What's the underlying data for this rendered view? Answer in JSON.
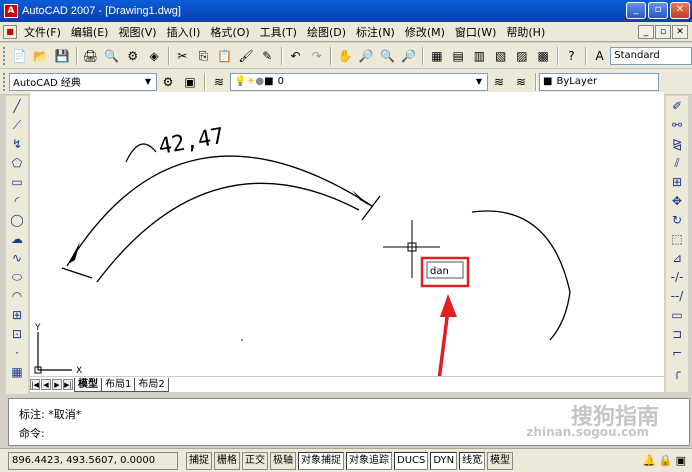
{
  "window": {
    "title": "AutoCAD 2007 - [Drawing1.dwg]",
    "app_badge": "A"
  },
  "menubar": {
    "items": [
      "文件(F)",
      "编辑(E)",
      "视图(V)",
      "插入(I)",
      "格式(O)",
      "工具(T)",
      "绘图(D)",
      "标注(N)",
      "修改(M)",
      "窗口(W)",
      "帮助(H)"
    ]
  },
  "toolbar_std": {
    "text_style": "Standard"
  },
  "toolbar_workspace": {
    "workspace": "AutoCAD 经典",
    "layer": "0",
    "linetype": "ByLayer"
  },
  "drawing": {
    "dimension_text": "42,47",
    "input_text": "dan",
    "ucs_x": "X",
    "ucs_y": "Y"
  },
  "layout_tabs": [
    "模型",
    "布局1",
    "布局2"
  ],
  "command": {
    "history": "标注: *取消*",
    "prompt": "命令:"
  },
  "status": {
    "coords": "896.4423, 493.5607, 0.0000",
    "buttons": [
      "捕捉",
      "栅格",
      "正交",
      "极轴",
      "对象捕捉",
      "对象追踪",
      "DUCS",
      "DYN",
      "线宽",
      "模型"
    ],
    "on_buttons": [
      "对象捕捉",
      "对象追踪",
      "DUCS",
      "DYN",
      "线宽"
    ]
  },
  "watermark": {
    "line1": "搜狗指南",
    "line2": "zhinan.sogou.com"
  },
  "colors": {
    "titlebar": "#0a4fc4",
    "annotation_red": "#e02020",
    "canvas": "#ffffff"
  }
}
